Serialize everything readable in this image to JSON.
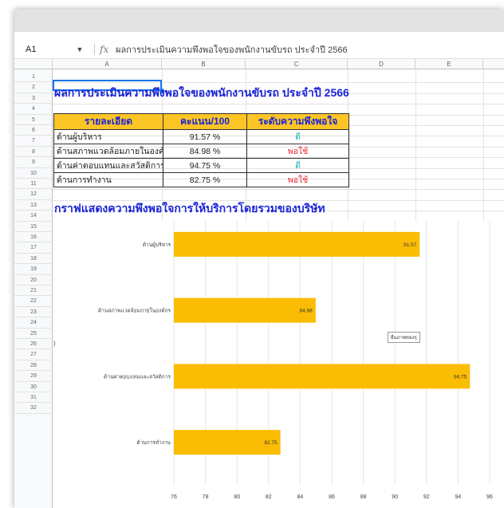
{
  "formula_bar": {
    "cell_ref": "A1",
    "fx_label": "fx",
    "content": "ผลการประเมินความพึงพอใจของพนักงานขับรถ ประจำปี 2566"
  },
  "columns": [
    "A",
    "B",
    "C",
    "D",
    "E"
  ],
  "rows": [
    "1",
    "2",
    "3",
    "4",
    "5",
    "6",
    "7",
    "8",
    "9",
    "10",
    "11",
    "12",
    "13",
    "14",
    "15",
    "16",
    "17",
    "18",
    "19",
    "20",
    "21",
    "22",
    "23",
    "24",
    "25",
    "26",
    "27",
    "28",
    "29",
    "30",
    "31",
    "32"
  ],
  "sheet": {
    "title": "ผลการประเมินความพึงพอใจของพนักงานขับรถ ประจำปี 2566",
    "table": {
      "headers": [
        "รายละเอียด",
        "คะแนน/100",
        "ระดับความพึงพอใจ"
      ],
      "rows": [
        {
          "detail": "ด้านผู้บริหาร",
          "score": "91.57 %",
          "level": "ดี"
        },
        {
          "detail": "ด้านสภาพแวดล้อมภายในองค์กร",
          "score": "84.98 %",
          "level": "พอใช้"
        },
        {
          "detail": "ด้านค่าตอบแทนและสวัสดิการ",
          "score": "94.75 %",
          "level": "ดี"
        },
        {
          "detail": "ด้านการทำงาน",
          "score": "82.75 %",
          "level": "พอใช้"
        }
      ]
    },
    "chart_title": "กราฟแสดงความพึงพอใจการให้บริการโดยรวมของบริษัท",
    "chart_tag": "ยืนภาพของรุ"
  },
  "colors": {
    "bar": "#fbbc04",
    "title_text": "#1a23d6",
    "header_fill": "#fcc526",
    "good_text": "#19b3b3",
    "ok_text": "#e8262b",
    "selection": "#1a73e8"
  },
  "chart_data": {
    "type": "bar",
    "orientation": "horizontal",
    "categories": [
      "ด้านผู้บริหาร",
      "ด้านสภาพแวดล้อมภายในองค์กร",
      "ด้านค่าตอบแทนและสวัสดิการ",
      "ด้านการทำงาน"
    ],
    "values": [
      91.57,
      84.98,
      94.75,
      82.75
    ],
    "value_labels": [
      "91.57",
      "84.98",
      "94.75",
      "82.75"
    ],
    "xlim": [
      76,
      96
    ],
    "xticks": [
      "76",
      "78",
      "80",
      "82",
      "84",
      "86",
      "88",
      "90",
      "92",
      "94",
      "96"
    ],
    "grid": true,
    "title": "",
    "xlabel": "",
    "ylabel": ""
  }
}
